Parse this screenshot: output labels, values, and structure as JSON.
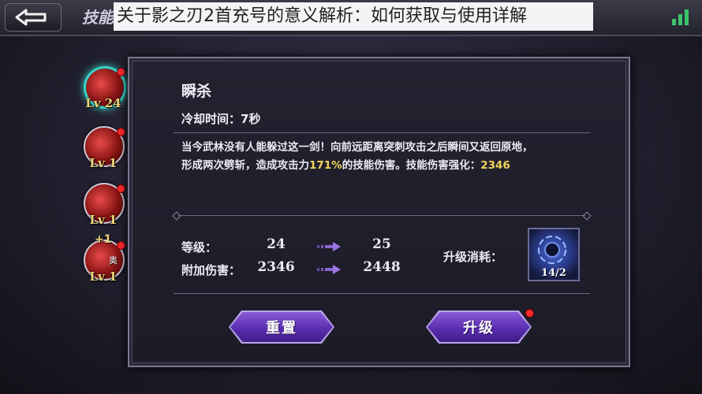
{
  "header": {
    "tab_title": "技能",
    "banner_title": "关于影之刃2首充号的意义解析：如何获取与使用详解"
  },
  "skills": [
    {
      "level": "Lv 24",
      "active": true
    },
    {
      "level": "Lv 1",
      "active": false
    },
    {
      "level": "Lv 1",
      "active": false
    },
    {
      "level": "Lv 1",
      "active": false,
      "plus": "+1",
      "tag": "奥"
    }
  ],
  "detail": {
    "name": "瞬杀",
    "cooldown": "冷却时间：7秒",
    "desc_1": "当今武林没有人能躲过这一剑！向前远距离突刺攻击之后瞬间又返回原地，",
    "desc_2a": "形成两次劈斩，造成攻击力",
    "desc_pct": "171%",
    "desc_2b": "的技能伤害。技能伤害强化：",
    "desc_val": "2346"
  },
  "stats": {
    "level_label": "等级：",
    "level_from": "24",
    "level_to": "25",
    "damage_label": "附加伤害：",
    "damage_from": "2346",
    "damage_to": "2448"
  },
  "cost": {
    "label": "升级消耗：",
    "count": "14/2"
  },
  "buttons": {
    "reset": "重置",
    "upgrade": "升级"
  },
  "colors": {
    "accent_purple": "#5a2eb0",
    "highlight_yellow": "#f2d35a",
    "level_gold": "#f3d77a",
    "notify_red": "#ff2a2a"
  }
}
